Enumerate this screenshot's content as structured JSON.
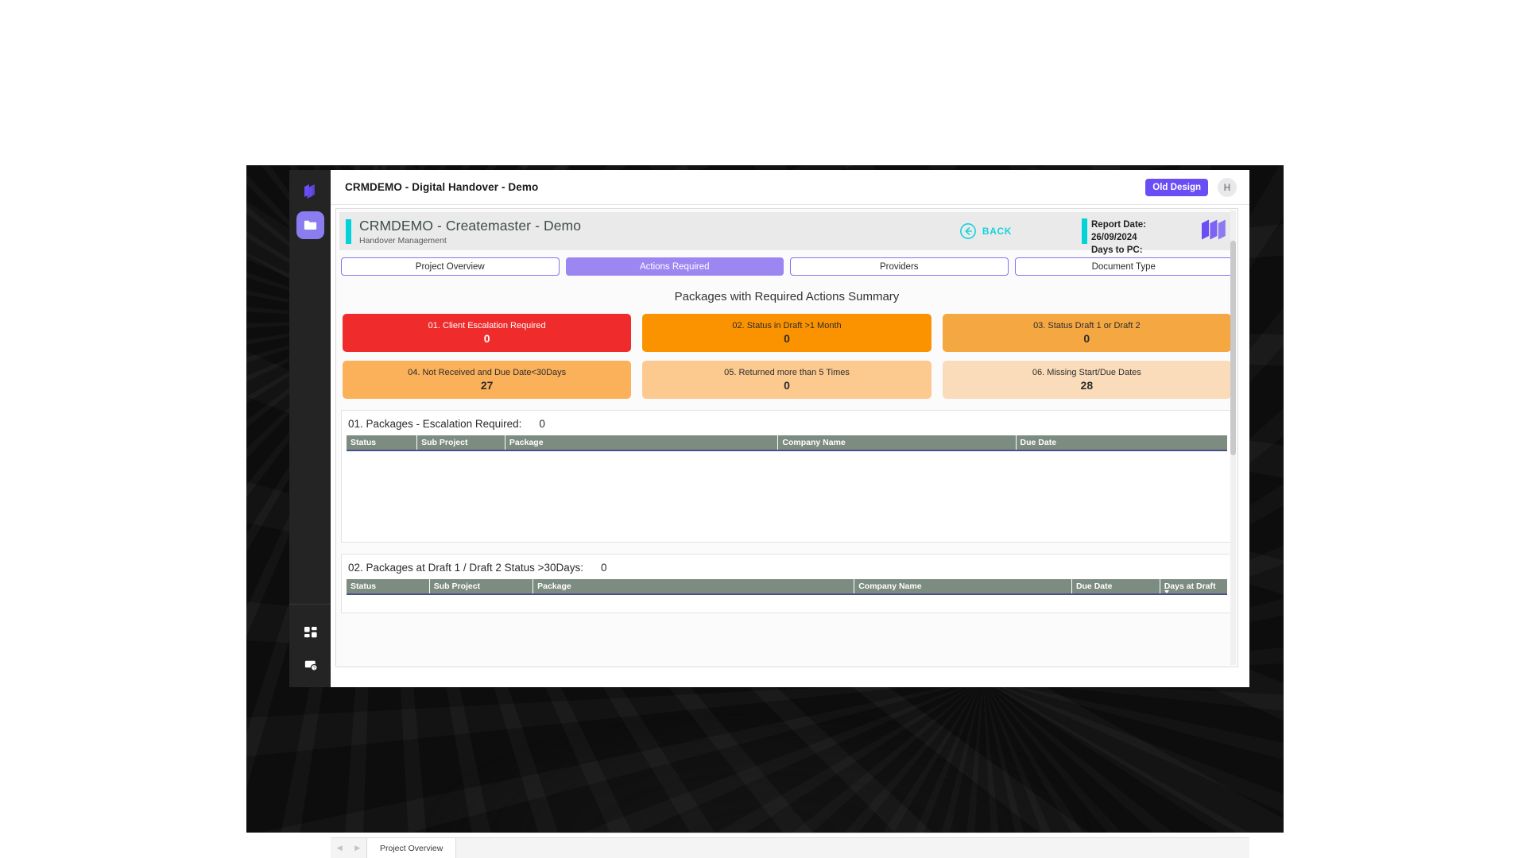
{
  "window": {
    "topbar_title": "CRMDEMO - Digital Handover - Demo",
    "old_design_label": "Old Design",
    "avatar_initial": "H"
  },
  "rail": {
    "logo_icon": "stacked-layers-logo-icon",
    "items": [
      {
        "name": "folder",
        "icon": "folder-icon",
        "active": true
      }
    ],
    "bottom_items": [
      {
        "name": "apps",
        "icon": "grid-apps-icon"
      },
      {
        "name": "support",
        "icon": "help-badge-icon"
      }
    ]
  },
  "report": {
    "title": "CRMDEMO - Createmaster - Demo",
    "subtitle": "Handover Management",
    "back_label": "BACK",
    "back_icon": "arrow-left-circle-icon",
    "report_date_label": "Report Date: 26/09/2024",
    "days_to_pc_label": "Days to PC:",
    "brand_logo_icon": "stacked-layers-logo-icon",
    "accent_color": "#00d4d8",
    "tabs": [
      {
        "label": "Project Overview",
        "active": false
      },
      {
        "label": "Actions Required",
        "active": true
      },
      {
        "label": "Providers",
        "active": false
      },
      {
        "label": "Document Type",
        "active": false
      }
    ],
    "summary_title": "Packages with Required Actions Summary",
    "kpis": [
      {
        "label": "01. Client Escalation Required",
        "value": "0",
        "bg": "#f02b2b",
        "fg": "#ffffff"
      },
      {
        "label": "02. Status in Draft >1 Month",
        "value": "0",
        "bg": "#fb9200",
        "fg": "#2d2d2d"
      },
      {
        "label": "03. Status Draft 1 or Draft 2",
        "value": "0",
        "bg": "#f5a742",
        "fg": "#2d2d2d"
      },
      {
        "label": "04. Not Received and Due Date<30Days",
        "value": "27",
        "bg": "#fbb05a",
        "fg": "#2d2d2d"
      },
      {
        "label": "05. Returned more than 5 Times",
        "value": "0",
        "bg": "#fcc98f",
        "fg": "#2d2d2d"
      },
      {
        "label": "06. Missing Start/Due Dates",
        "value": "28",
        "bg": "#fadcba",
        "fg": "#2d2d2d"
      }
    ],
    "tables": [
      {
        "heading": "01. Packages - Escalation Required:",
        "count": "0",
        "columns": [
          "Status",
          "Sub Project",
          "Package",
          "Company Name",
          "Due Date"
        ],
        "column_widths": [
          "8%",
          "10%",
          "31%",
          "27%",
          "24%"
        ],
        "sorted_column_index": -1,
        "rows": []
      },
      {
        "heading": "02. Packages at Draft 1 / Draft 2 Status >30Days:",
        "count": "0",
        "columns": [
          "Status",
          "Sub Project",
          "Package",
          "Company Name",
          "Due Date",
          "Days at Draft"
        ],
        "column_widths": [
          "8%",
          "10%",
          "31%",
          "21%",
          "8.5%",
          "6.5%"
        ],
        "sorted_column_index": 5,
        "rows": []
      }
    ]
  },
  "footer": {
    "prev_icon": "chevron-left-icon",
    "next_icon": "chevron-right-icon",
    "tabs": [
      {
        "label": "Project Overview"
      }
    ]
  }
}
